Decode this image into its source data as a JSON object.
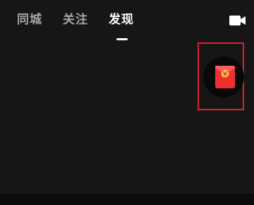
{
  "header": {
    "tabs": [
      {
        "label": "同城",
        "active": false
      },
      {
        "label": "关注",
        "active": false
      },
      {
        "label": "发现",
        "active": true
      }
    ],
    "camera_icon": "video-camera-icon"
  },
  "floating": {
    "red_packet_icon": "red-packet-icon",
    "highlight_color": "#e0202a"
  },
  "colors": {
    "background": "#161616",
    "active_tab": "#ffffff",
    "inactive_tab": "#a6a6a6",
    "red_packet": "#ef2f2f"
  }
}
